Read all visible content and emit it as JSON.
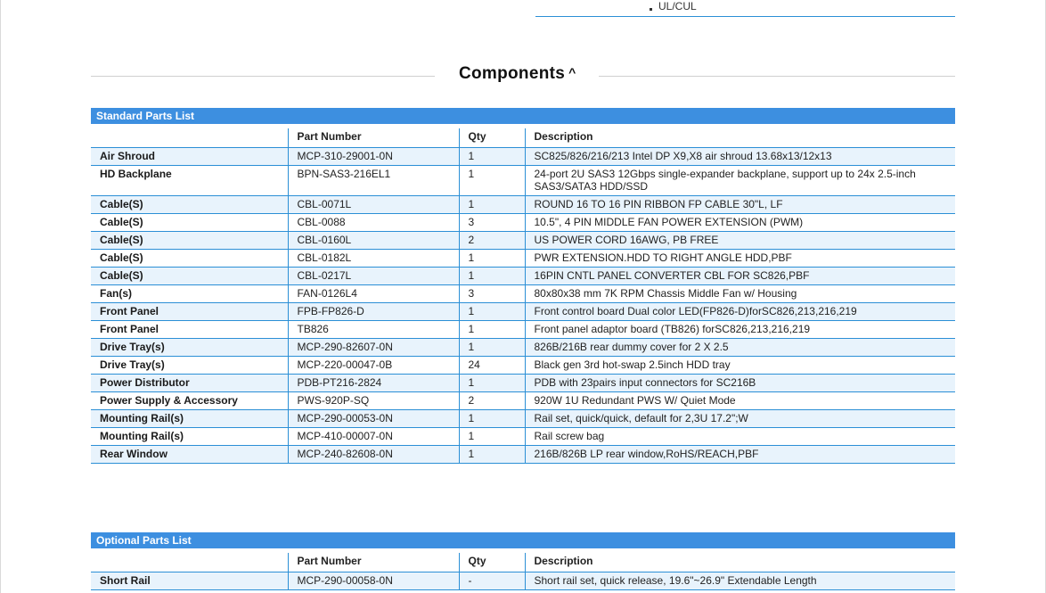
{
  "certifications": {
    "last_item": "UL/CUL"
  },
  "section": {
    "title": "Components",
    "toggle_icon": "chevron-up-icon"
  },
  "standard": {
    "heading": "Standard Parts List",
    "columns": [
      "",
      "Part Number",
      "Qty",
      "Description"
    ],
    "rows": [
      {
        "name": "Air Shroud",
        "part": "MCP-310-29001-0N",
        "qty": "1",
        "desc": "SC825/826/216/213 Intel DP X9,X8 air shroud 13.68x13/12x13"
      },
      {
        "name": "HD Backplane",
        "part": "BPN-SAS3-216EL1",
        "qty": "1",
        "desc": "24-port 2U SAS3 12Gbps single-expander backplane, support up to 24x 2.5-inch SAS3/SATA3 HDD/SSD"
      },
      {
        "name": "Cable(S)",
        "part": "CBL-0071L",
        "qty": "1",
        "desc": "ROUND 16 TO 16 PIN RIBBON FP CABLE 30\"L, LF"
      },
      {
        "name": "Cable(S)",
        "part": "CBL-0088",
        "qty": "3",
        "desc": "10.5\", 4 PIN MIDDLE FAN POWER EXTENSION (PWM)"
      },
      {
        "name": "Cable(S)",
        "part": "CBL-0160L",
        "qty": "2",
        "desc": "US POWER CORD 16AWG, PB FREE"
      },
      {
        "name": "Cable(S)",
        "part": "CBL-0182L",
        "qty": "1",
        "desc": "PWR EXTENSION.HDD TO RIGHT ANGLE HDD,PBF"
      },
      {
        "name": "Cable(S)",
        "part": "CBL-0217L",
        "qty": "1",
        "desc": "16PIN CNTL PANEL CONVERTER CBL FOR SC826,PBF"
      },
      {
        "name": "Fan(s)",
        "part": "FAN-0126L4",
        "qty": "3",
        "desc": "80x80x38 mm 7K RPM Chassis Middle Fan w/ Housing"
      },
      {
        "name": "Front Panel",
        "part": "FPB-FP826-D",
        "qty": "1",
        "desc": "Front control board Dual color LED(FP826-D)forSC826,213,216,219"
      },
      {
        "name": "Front Panel",
        "part": "TB826",
        "qty": "1",
        "desc": "Front panel adaptor board (TB826) forSC826,213,216,219"
      },
      {
        "name": "Drive Tray(s)",
        "part": "MCP-290-82607-0N",
        "qty": "1",
        "desc": "826B/216B rear dummy cover for 2 X 2.5"
      },
      {
        "name": "Drive Tray(s)",
        "part": "MCP-220-00047-0B",
        "qty": "24",
        "desc": "Black gen 3rd hot-swap 2.5inch HDD tray"
      },
      {
        "name": "Power Distributor",
        "part": "PDB-PT216-2824",
        "qty": "1",
        "desc": "PDB with 23pairs input connectors for SC216B"
      },
      {
        "name": "Power Supply & Accessory",
        "part": "PWS-920P-SQ",
        "qty": "2",
        "desc": "920W 1U Redundant PWS W/ Quiet Mode"
      },
      {
        "name": "Mounting Rail(s)",
        "part": "MCP-290-00053-0N",
        "qty": "1",
        "desc": "Rail set, quick/quick, default for 2,3U 17.2\";W"
      },
      {
        "name": "Mounting Rail(s)",
        "part": "MCP-410-00007-0N",
        "qty": "1",
        "desc": "Rail screw bag"
      },
      {
        "name": "Rear Window",
        "part": "MCP-240-82608-0N",
        "qty": "1",
        "desc": "216B/826B LP rear window,RoHS/REACH,PBF"
      }
    ]
  },
  "optional": {
    "heading": "Optional Parts List",
    "columns": [
      "",
      "Part Number",
      "Qty",
      "Description"
    ],
    "rows": [
      {
        "name": "Short Rail",
        "part": "MCP-290-00058-0N",
        "qty": "-",
        "desc": "Short rail set, quick release, 19.6\"~26.9\" Extendable Length"
      }
    ]
  }
}
